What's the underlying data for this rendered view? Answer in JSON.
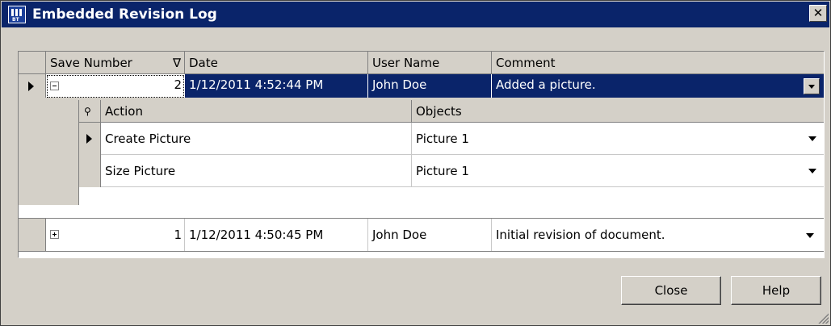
{
  "window": {
    "title": "Embedded Revision Log"
  },
  "columns": {
    "save_number": "Save Number",
    "date": "Date",
    "user_name": "User Name",
    "comment": "Comment"
  },
  "rows": [
    {
      "save_number": "2",
      "date": "1/12/2011 4:52:44 PM",
      "user_name": "John Doe",
      "comment": "Added a picture.",
      "expanded": true,
      "selected": true
    },
    {
      "save_number": "1",
      "date": "1/12/2011 4:50:45 PM",
      "user_name": "John Doe",
      "comment": "Initial revision of document.",
      "expanded": false,
      "selected": false
    }
  ],
  "child_table": {
    "columns": {
      "action": "Action",
      "objects": "Objects"
    },
    "rows": [
      {
        "action": "Create Picture",
        "objects": "Picture 1"
      },
      {
        "action": "Size Picture",
        "objects": "Picture 1"
      }
    ]
  },
  "buttons": {
    "close": "Close",
    "help": "Help"
  },
  "icons": {
    "app": "app-logo-icon",
    "sort": "sort-descending-icon",
    "search": "search-icon",
    "close": "close-icon"
  },
  "colors": {
    "titlebar": "#0a246a",
    "selection": "#0a246a",
    "dialog": "#d4d0c8"
  }
}
